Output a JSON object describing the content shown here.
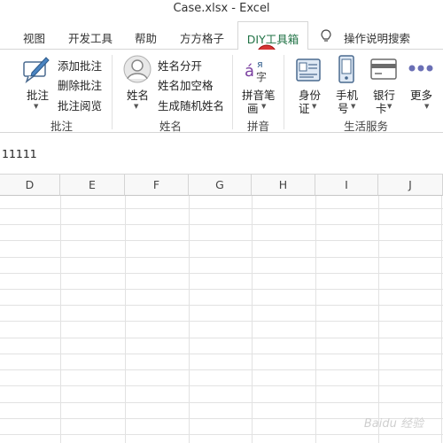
{
  "window": {
    "title": "Case.xlsx  -  Excel"
  },
  "tabs": [
    {
      "label": "视图",
      "active": false
    },
    {
      "label": "开发工具",
      "active": false
    },
    {
      "label": "帮助",
      "active": false
    },
    {
      "label": "方方格子",
      "active": false
    },
    {
      "label": "DIY工具箱",
      "active": true
    },
    {
      "label": "操作说明搜索",
      "active": false
    }
  ],
  "ribbon": {
    "comment_group": {
      "label": "批注",
      "big_button": "批注",
      "items": [
        "添加批注",
        "删除批注",
        "批注阅览"
      ]
    },
    "name_group": {
      "label": "姓名",
      "big_button": "姓名",
      "items": [
        "姓名分开",
        "姓名加空格",
        "生成随机姓名"
      ]
    },
    "pinyin_group": {
      "label": "拼音",
      "big_button_line1": "拼音笔",
      "big_button_line2": "画"
    },
    "life_group": {
      "label": "生活服务",
      "buttons": [
        {
          "line1": "身份",
          "line2": "证"
        },
        {
          "line1": "手机",
          "line2": "号"
        },
        {
          "line1": "银行",
          "line2": "卡"
        },
        {
          "line1": "更多",
          "line2": ""
        }
      ]
    }
  },
  "formula_bar": {
    "value": "11111"
  },
  "columns": [
    "D",
    "E",
    "F",
    "G",
    "H",
    "I",
    "J"
  ],
  "colors": {
    "accent": "#217346",
    "grid_line": "#e2e2e2",
    "cursor_red": "#d32020"
  },
  "watermark": "Baidu 经验"
}
